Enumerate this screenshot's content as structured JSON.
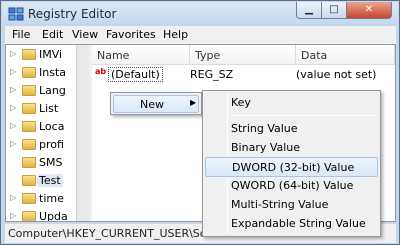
{
  "window": {
    "title": "Registry Editor"
  },
  "menu": [
    "File",
    "Edit",
    "View",
    "Favorites",
    "Help"
  ],
  "tree_items": [
    {
      "label": "IMVi",
      "selected": false
    },
    {
      "label": "Insta",
      "selected": false
    },
    {
      "label": "Lang",
      "selected": false
    },
    {
      "label": "List",
      "selected": false
    },
    {
      "label": "Loca",
      "selected": false
    },
    {
      "label": "profi",
      "selected": false
    },
    {
      "label": "SMS",
      "selected": false
    },
    {
      "label": "Test",
      "selected": true
    },
    {
      "label": "time",
      "selected": false
    },
    {
      "label": "Upda",
      "selected": false
    }
  ],
  "list": {
    "columns": [
      "Name",
      "Type",
      "Data"
    ],
    "rows": [
      {
        "name": "(Default)",
        "type": "REG_SZ",
        "data": "(value not set)"
      }
    ]
  },
  "context_menu": {
    "new_label": "New"
  },
  "submenu": [
    "Key",
    "String Value",
    "Binary Value",
    "DWORD (32-bit) Value",
    "QWORD (64-bit) Value",
    "Multi-String Value",
    "Expandable String Value"
  ],
  "submenu_highlighted": "DWORD (32-bit) Value",
  "status": {
    "path": "Computer\\HKEY_CURRENT_USER\\Software"
  }
}
